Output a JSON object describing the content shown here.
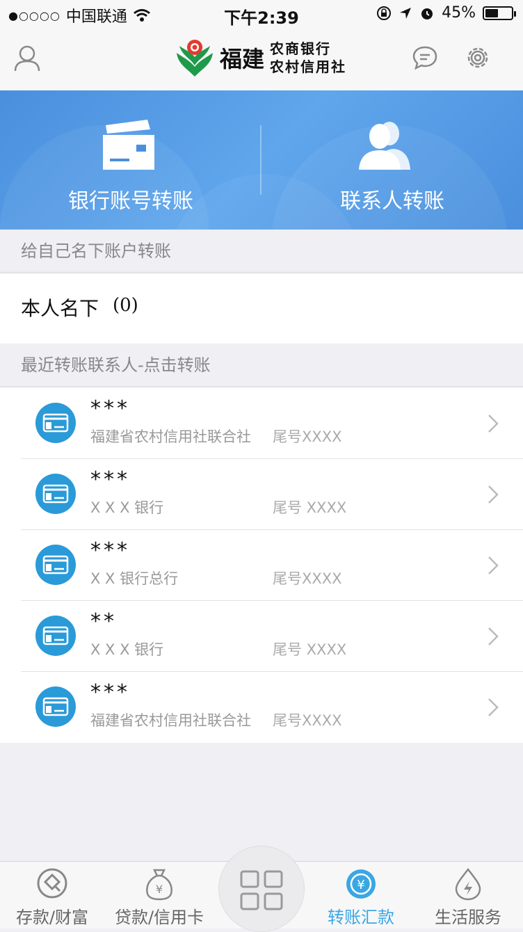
{
  "status": {
    "carrier": "中国联通",
    "time": "下午2:39",
    "battery": "45%",
    "battery_level": 0.45
  },
  "header": {
    "logo_big": "福建",
    "logo_line1": "农商银行",
    "logo_line2": "农村信用社"
  },
  "banner": {
    "left_label": "银行账号转账",
    "right_label": "联系人转账"
  },
  "own": {
    "section": "给自己名下账户转账",
    "label": "本人名下",
    "count": "(0)"
  },
  "recent": {
    "section": "最近转账联系人-点击转账",
    "items": [
      {
        "name": "***",
        "bank": "福建省农村信用社联合社",
        "tail": "尾号XXXX"
      },
      {
        "name": "***",
        "bank": "X X X 银行",
        "tail": "尾号 XXXX"
      },
      {
        "name": "***",
        "bank": "X X 银行总行",
        "tail": "尾号XXXX"
      },
      {
        "name": "**",
        "bank": "X X X 银行",
        "tail": "尾号 XXXX"
      },
      {
        "name": "***",
        "bank": "福建省农村信用社联合社",
        "tail": "尾号XXXX"
      }
    ]
  },
  "tabs": [
    {
      "label": "存款/财富"
    },
    {
      "label": "贷款/信用卡"
    },
    {
      "label": "转账汇款"
    },
    {
      "label": "生活服务"
    }
  ],
  "colors": {
    "accent": "#3aa7e3",
    "banner": "#4a8fdd",
    "card_icon": "#2a9ad8"
  }
}
